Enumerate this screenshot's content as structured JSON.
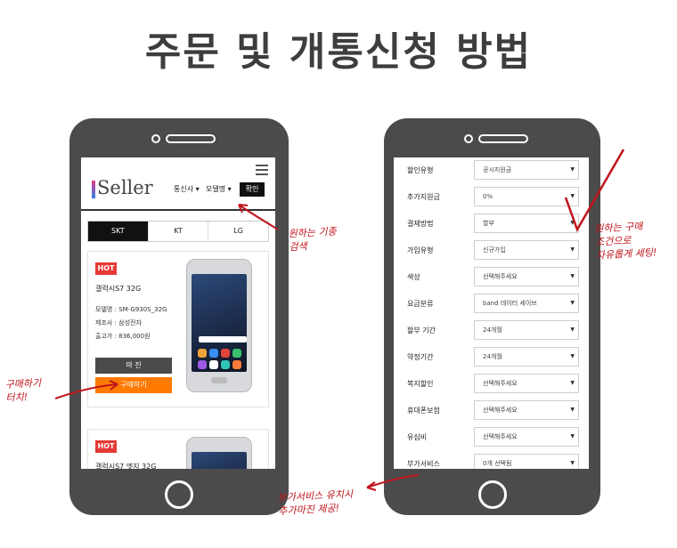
{
  "page": {
    "title": "주문 및 개통신청 방법"
  },
  "left_phone": {
    "logo": "Seller",
    "filters": {
      "telecom": "통신사 ▾",
      "model": "모델명 ▾",
      "confirm": "확인"
    },
    "tabs": [
      "SKT",
      "KT",
      "LG"
    ],
    "products": [
      {
        "badge": "HOT",
        "name": "갤럭시S7 32G",
        "model": "모델명 : SM-G930S_32G",
        "maker": "제조사 : 삼성전자",
        "price": "출고가 : 836,000원",
        "closed_label": "마 진",
        "buy_label": "구매하기"
      },
      {
        "badge": "HOT",
        "name": "갤럭시S7 엣지 32G"
      }
    ]
  },
  "right_phone": {
    "rows": [
      {
        "label": "할인유형",
        "value": "공시지원금"
      },
      {
        "label": "추가지원금",
        "value": "0%"
      },
      {
        "label": "결제방법",
        "value": "할부"
      },
      {
        "label": "가입유형",
        "value": "신규가입"
      },
      {
        "label": "색상",
        "value": "선택해주세요"
      },
      {
        "label": "요금분류",
        "value": "band 데이터 세이브"
      },
      {
        "label": "할부 기간",
        "value": "24개월"
      },
      {
        "label": "약정기간",
        "value": "24개월"
      },
      {
        "label": "복지할인",
        "value": "선택해주세요"
      },
      {
        "label": "휴대폰보험",
        "value": "선택해주세요"
      },
      {
        "label": "유심비",
        "value": "선택해주세요"
      },
      {
        "label": "부가서비스",
        "value": "0개 선택됨"
      }
    ]
  },
  "annotations": {
    "search": "원하는 기종\n검색",
    "buy": "구매하기\n터치!",
    "conditions": "원하는 구매\n조건으로\n자유롭게 세팅!",
    "extra": "부가서비스 유치시\n추가마진 제공!"
  },
  "colors": {
    "accent_red": "#c0141b",
    "buy_orange": "#ff7a00",
    "hot_red": "#e53935",
    "phone_body": "#4b4b4b"
  }
}
